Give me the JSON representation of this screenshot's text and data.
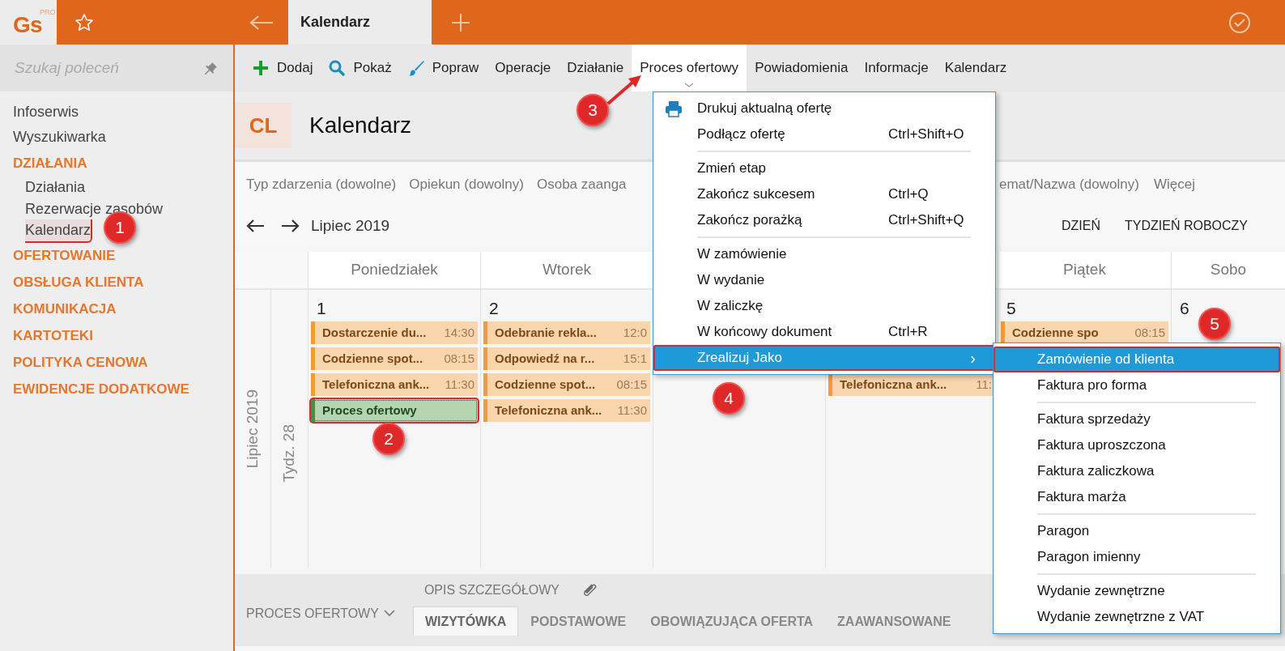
{
  "app": {
    "logo": "Gs",
    "logo_badge": "PRO"
  },
  "tabs": [
    {
      "label": "Kalendarz",
      "selected": true
    }
  ],
  "sidebar": {
    "search": {
      "placeholder": "Szukaj poleceń"
    },
    "items": [
      {
        "label": "Infoserwis",
        "kind": "link",
        "selected": false
      },
      {
        "label": "Wyszukiwarka",
        "kind": "link",
        "selected": false
      },
      {
        "label": "DZIAŁANIA",
        "kind": "group",
        "selected": false,
        "children": [
          {
            "label": "Działania",
            "selected": false
          },
          {
            "label": "Rezerwacje zasobów",
            "selected": false
          },
          {
            "label": "Kalendarz",
            "selected": true
          }
        ]
      },
      {
        "label": "OFERTOWANIE",
        "kind": "group",
        "selected": false
      },
      {
        "label": "OBSŁUGA KLIENTA",
        "kind": "group",
        "selected": false
      },
      {
        "label": "KOMUNIKACJA",
        "kind": "group",
        "selected": false
      },
      {
        "label": "KARTOTEKI",
        "kind": "group",
        "selected": false
      },
      {
        "label": "POLITYKA CENOWA",
        "kind": "group",
        "selected": false
      },
      {
        "label": "EWIDENCJE DODATKOWE",
        "kind": "group",
        "selected": false
      }
    ]
  },
  "toolbar": [
    {
      "label": "Dodaj",
      "selected": false
    },
    {
      "label": "Pokaż",
      "selected": false
    },
    {
      "label": "Popraw",
      "selected": false
    },
    {
      "label": "Operacje",
      "selected": false
    },
    {
      "label": "Działanie",
      "selected": false
    },
    {
      "label": "Proces ofertowy",
      "selected": true
    },
    {
      "label": "Powiadomienia",
      "selected": false
    },
    {
      "label": "Informacje",
      "selected": false
    },
    {
      "label": "Kalendarz",
      "selected": false
    }
  ],
  "header": {
    "badge": "CL",
    "title": "Kalendarz"
  },
  "filters_left": [
    "Typ zdarzenia (dowolne)",
    "Opiekun (dowolny)",
    "Osoba zaanga"
  ],
  "filters_right": [
    "emat/Nazwa (dowolny)",
    "Więcej"
  ],
  "nav": {
    "period": "Lipiec 2019",
    "views": [
      "DZIEŃ",
      "TYDZIEŃ ROBOCZY"
    ]
  },
  "calendar": {
    "month": "Lipiec 2019",
    "week": "Tydz. 28",
    "columns": [
      {
        "header": "Poniedziałek",
        "day": "1",
        "events": [
          {
            "kind": "task",
            "title": "Dostarczenie du...",
            "time": "14:30"
          },
          {
            "kind": "task",
            "title": "Codzienne spot...",
            "time": "08:15"
          },
          {
            "kind": "task",
            "title": "Telefoniczna ank...",
            "time": "11:30"
          },
          {
            "kind": "offer",
            "title": "Proces ofertowy",
            "annotated": true
          }
        ]
      },
      {
        "header": "Wtorek",
        "day": "2",
        "events": [
          {
            "kind": "task",
            "title": "Odebranie rekla...",
            "time": "12:0"
          },
          {
            "kind": "task",
            "title": "Odpowiedź na r...",
            "time": "15:1"
          },
          {
            "kind": "task",
            "title": "Codzienne spot...",
            "time": "08:15"
          },
          {
            "kind": "task",
            "title": "Telefoniczna ank...",
            "time": "11:30"
          }
        ]
      },
      {},
      {
        "events": [
          {
            "kind": "gap"
          },
          {
            "kind": "gap"
          },
          {
            "kind": "task",
            "title": "Telefoniczna ank...",
            "time": "11:"
          }
        ]
      },
      {
        "header": "Piątek",
        "day": "5",
        "events": [
          {
            "kind": "task",
            "title": "Codzienne spo",
            "time": "08:15"
          }
        ]
      },
      {
        "header": "Sobo",
        "day": "6"
      }
    ]
  },
  "bottom": {
    "section": "PROCES OFERTOWY",
    "detail": "OPIS SZCZEGÓŁOWY",
    "tabs": [
      {
        "label": "WIZYTÓWKA",
        "selected": true
      },
      {
        "label": "PODSTAWOWE",
        "selected": false
      },
      {
        "label": "OBOWIĄZUJĄCA OFERTA",
        "selected": false
      },
      {
        "label": "ZAAWANSOWANE",
        "selected": false
      }
    ]
  },
  "menu": [
    {
      "kind": "item",
      "label": "Drukuj aktualną ofertę",
      "highlighted": false
    },
    {
      "kind": "item",
      "label": "Podłącz ofertę",
      "shortcut": "Ctrl+Shift+O",
      "highlighted": false
    },
    {
      "kind": "separator"
    },
    {
      "kind": "item",
      "label": "Zmień etap",
      "highlighted": false
    },
    {
      "kind": "item",
      "label": "Zakończ sukcesem",
      "shortcut": "Ctrl+Q",
      "highlighted": false
    },
    {
      "kind": "item",
      "label": "Zakończ porażką",
      "shortcut": "Ctrl+Shift+Q",
      "highlighted": false
    },
    {
      "kind": "separator"
    },
    {
      "kind": "item",
      "label": "W zamówienie",
      "highlighted": false
    },
    {
      "kind": "item",
      "label": "W wydanie",
      "highlighted": false
    },
    {
      "kind": "item",
      "label": "W zaliczkę",
      "highlighted": false
    },
    {
      "kind": "item",
      "label": "W końcowy dokument",
      "shortcut": "Ctrl+R",
      "highlighted": false
    },
    {
      "kind": "submenu",
      "label": "Zrealizuj Jako",
      "arrow": "›",
      "highlighted": true,
      "annotated": true
    }
  ],
  "submenu": [
    {
      "kind": "item",
      "label": "Zamówienie od klienta",
      "highlighted": true,
      "annotated": true
    },
    {
      "kind": "item",
      "label": "Faktura pro forma",
      "highlighted": false
    },
    {
      "kind": "separator"
    },
    {
      "kind": "item",
      "label": "Faktura sprzedaży",
      "highlighted": false
    },
    {
      "kind": "item",
      "label": "Faktura uproszczona",
      "highlighted": false
    },
    {
      "kind": "item",
      "label": "Faktura zaliczkowa",
      "highlighted": false
    },
    {
      "kind": "item",
      "label": "Faktura marża",
      "highlighted": false
    },
    {
      "kind": "separator"
    },
    {
      "kind": "item",
      "label": "Paragon",
      "highlighted": false
    },
    {
      "kind": "item",
      "label": "Paragon imienny",
      "highlighted": false
    },
    {
      "kind": "separator"
    },
    {
      "kind": "item",
      "label": "Wydanie zewnętrzne",
      "highlighted": false
    },
    {
      "kind": "item",
      "label": "Wydanie zewnętrzne z VAT",
      "highlighted": false
    }
  ],
  "annotations": [
    {
      "label": "1"
    },
    {
      "label": "2"
    },
    {
      "label": "3"
    },
    {
      "label": "4"
    },
    {
      "label": "5"
    }
  ]
}
